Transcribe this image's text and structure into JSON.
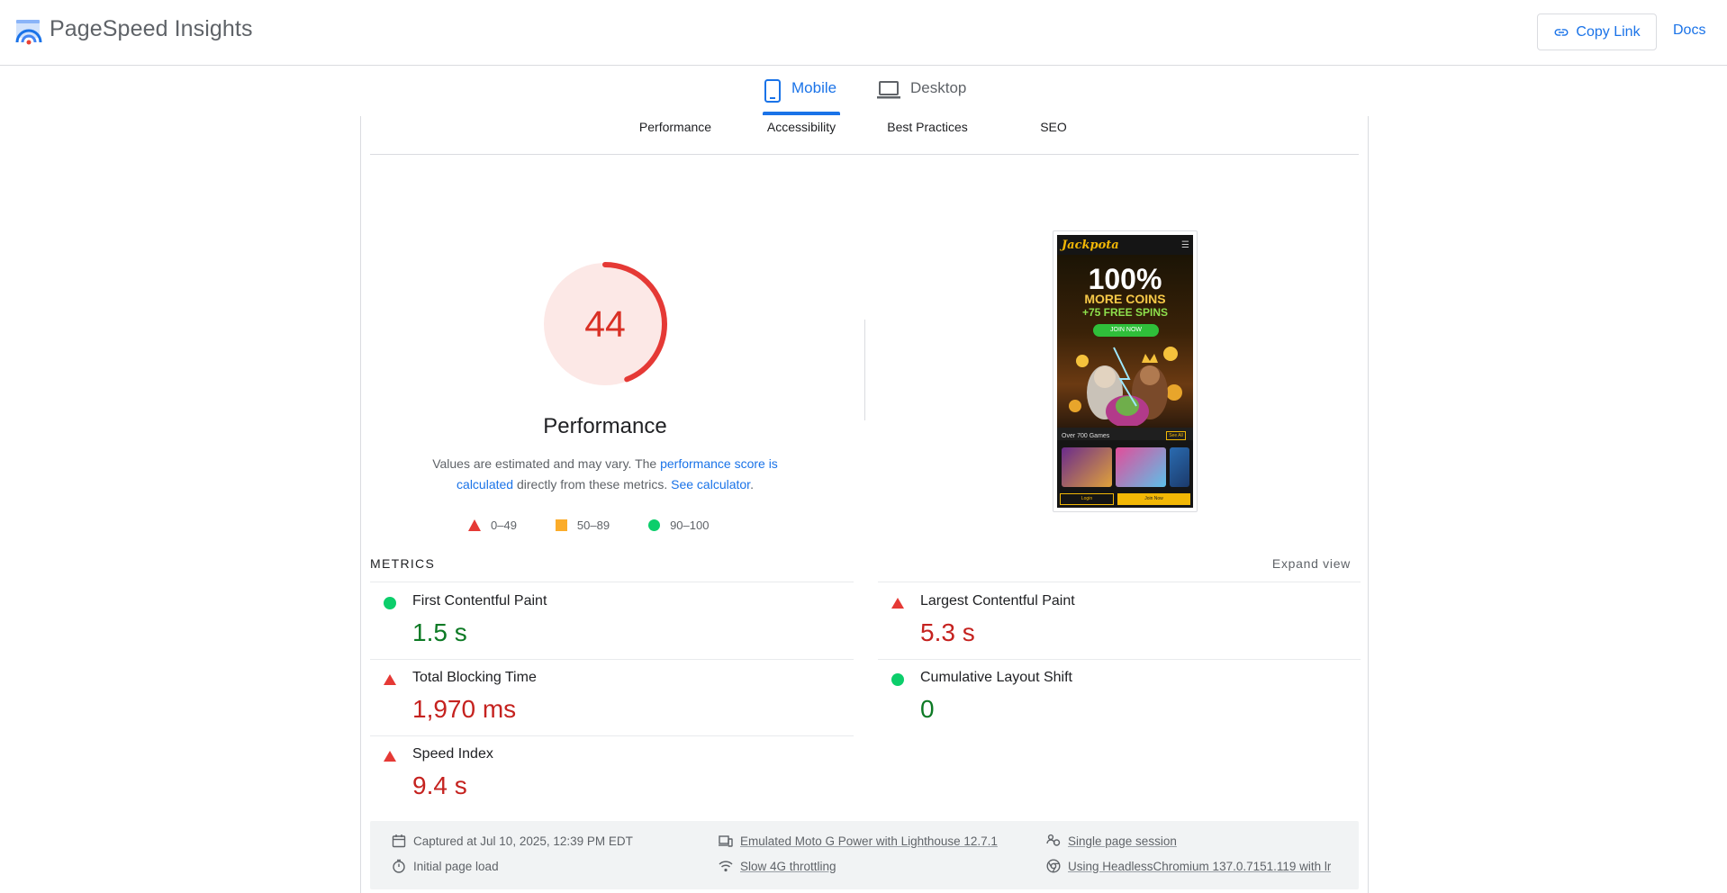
{
  "header": {
    "brand": "PageSpeed Insights",
    "copy_link": "Copy Link",
    "docs": "Docs"
  },
  "device_tabs": {
    "mobile": "Mobile",
    "desktop": "Desktop",
    "active": "Mobile"
  },
  "category_tabs": [
    "Performance",
    "Accessibility",
    "Best Practices",
    "SEO"
  ],
  "gauge": {
    "score": "44",
    "title": "Performance",
    "score_value": 44,
    "color": "#d93025",
    "bg_color": "#fce8e6"
  },
  "description": {
    "prefix": "Values are estimated and may vary. The ",
    "link1": "performance score is calculated",
    "middle": " directly from these metrics. ",
    "link2": "See calculator",
    "suffix": "."
  },
  "legend": [
    {
      "shape": "triangle",
      "color": "#e53935",
      "label": "0–49"
    },
    {
      "shape": "square",
      "color": "#fbac2a",
      "label": "50–89"
    },
    {
      "shape": "circle",
      "color": "#0cce6b",
      "label": "90–100"
    }
  ],
  "screenshot": {
    "logo": "Jackpota",
    "headline": "100%",
    "more_coins": "MORE COINS",
    "free_spins": "+75 FREE SPINS",
    "join_cta": "JOIN NOW",
    "games_label": "Over 700 Games",
    "see_all": "See All",
    "login": "Login",
    "join_now": "Join Now"
  },
  "metrics": {
    "label": "METRICS",
    "expand": "Expand view",
    "items": [
      {
        "name": "First Contentful Paint",
        "value": "1.5 s",
        "status": "good"
      },
      {
        "name": "Largest Contentful Paint",
        "value": "5.3 s",
        "status": "bad"
      },
      {
        "name": "Total Blocking Time",
        "value": "1,970 ms",
        "status": "bad"
      },
      {
        "name": "Cumulative Layout Shift",
        "value": "0",
        "status": "good"
      },
      {
        "name": "Speed Index",
        "value": "9.4 s",
        "status": "bad"
      }
    ]
  },
  "info": {
    "captured": "Captured at Jul 10, 2025, 12:39 PM EDT",
    "initial_load": "Initial page load",
    "emulated": "Emulated Moto G Power with Lighthouse 12.7.1",
    "throttling": "Slow 4G throttling",
    "session": "Single page session",
    "browser": "Using HeadlessChromium 137.0.7151.119 with lr"
  },
  "colors": {
    "accent": "#1a73e8",
    "fail": "#c5221f",
    "pass": "#0d7a25"
  }
}
